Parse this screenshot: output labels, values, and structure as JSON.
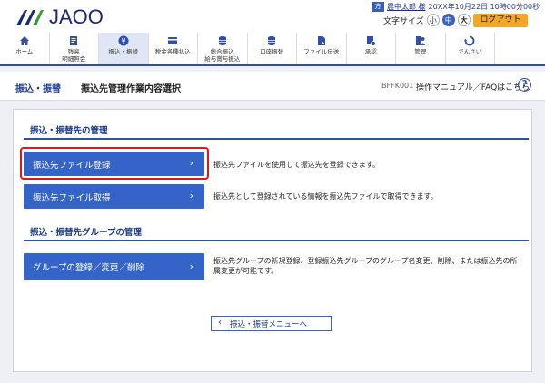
{
  "header": {
    "logo_text": "JAOO",
    "user_badge": "方",
    "user_name": "農中太郎 様",
    "datetime": "20XX年10月22日 10時00分00秒",
    "font_size_label": "文字サイズ",
    "font_small": "小",
    "font_medium": "中",
    "font_large": "大",
    "logout_label": "ログアウト"
  },
  "nav": {
    "items": [
      {
        "label": "ホーム",
        "icon": "home-icon"
      },
      {
        "label": "残高\n明細照会",
        "icon": "document-icon"
      },
      {
        "label": "振込・振替",
        "icon": "yen-coin-icon"
      },
      {
        "label": "税金各種払込",
        "icon": "payment-card-icon"
      },
      {
        "label": "総合振込\n給与賞与振込",
        "icon": "database-icon"
      },
      {
        "label": "口座振替",
        "icon": "database-icon"
      },
      {
        "label": "ファイル伝送",
        "icon": "file-icon"
      },
      {
        "label": "承認",
        "icon": "approval-icon"
      },
      {
        "label": "管理",
        "icon": "manager-icon"
      },
      {
        "label": "でんさい",
        "icon": "cycle-icon"
      }
    ],
    "active_index": 2
  },
  "titlebar": {
    "breadcrumb": "振込・振替",
    "page_title": "振込先管理作業内容選択",
    "screen_id": "BFFK001",
    "manual_link": "操作マニュアル／FAQはこちら",
    "help_icon": "?"
  },
  "sections": [
    {
      "title": "振込・振替先の管理",
      "actions": [
        {
          "label": "振込先ファイル登録",
          "description": "振込先ファイルを使用して振込先を登録できます。",
          "highlighted": true
        },
        {
          "label": "振込先ファイル取得",
          "description": "振込先として登録されている情報を振込先ファイルで取得できます。",
          "highlighted": false
        }
      ]
    },
    {
      "title": "振込・振替先グループの管理",
      "actions": [
        {
          "label": "グループの登録／変更／削除",
          "description": "振込先グループの新規登録、登録振込先グループのグループ名変更、削除、または振込先の所属変更が可能です。",
          "highlighted": false
        }
      ]
    }
  ],
  "back_button": {
    "label": "振込・振替メニューへ"
  },
  "colors": {
    "primary": "#3564c8",
    "navy": "#1a3a8c",
    "highlight": "#e01818",
    "logout": "#f5a623"
  }
}
